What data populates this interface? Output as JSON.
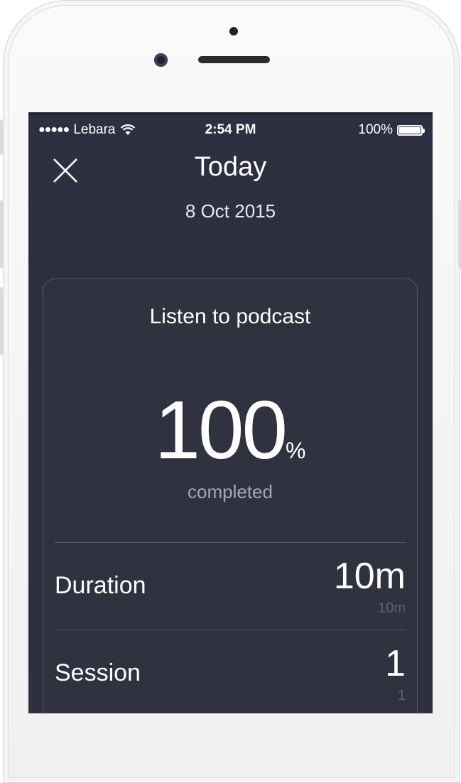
{
  "status_bar": {
    "signal": "●●●●●",
    "carrier": "Lebara",
    "time": "2:54 PM",
    "battery": "100%"
  },
  "header": {
    "title": "Today",
    "date": "8 Oct 2015"
  },
  "card": {
    "goal": "Listen to podcast",
    "progress_value": "100",
    "progress_unit": "%",
    "progress_label": "completed",
    "rows": [
      {
        "label": "Duration",
        "value": "10m",
        "sub": "10m"
      },
      {
        "label": "Session",
        "value": "1",
        "sub": "1"
      }
    ]
  },
  "colors": {
    "screen_bg": "#2e3041",
    "card_border": "#54576a",
    "muted_text": "#a6a8b5"
  },
  "icons": {
    "close": "close-icon",
    "wifi": "wifi-icon",
    "battery": "battery-icon"
  }
}
